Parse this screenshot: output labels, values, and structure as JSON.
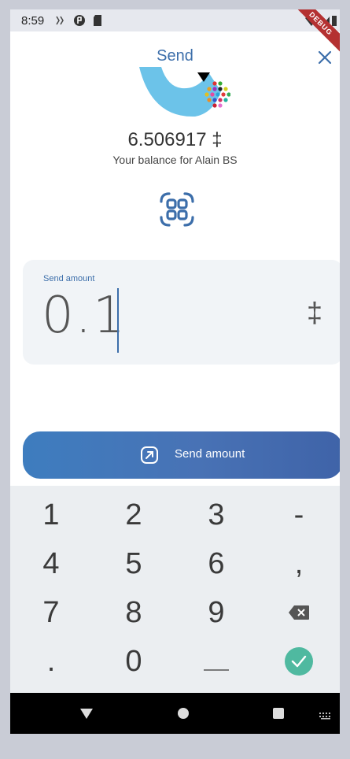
{
  "status_bar": {
    "time": "8:59",
    "debug_banner": "DEBUG"
  },
  "header": {
    "title": "Send"
  },
  "balance": {
    "value": "6.506917 ‡",
    "label": "Your balance for Alain BS"
  },
  "amount": {
    "label": "Send amount",
    "value": "0.1",
    "currency_symbol": "‡"
  },
  "send_button": {
    "label": "Send amount",
    "icon": "send-arrow-icon"
  },
  "keypad": {
    "keys": [
      "1",
      "2",
      "3",
      "-",
      "4",
      "5",
      "6",
      ",",
      "7",
      "8",
      "9",
      "backspace",
      ".",
      "0",
      "space",
      "done"
    ]
  },
  "colors": {
    "accent": "#3c6eaa",
    "card_bg": "#f1f4f7",
    "keypad_bg": "#ebeef1",
    "done_key": "#4fb9a0"
  }
}
